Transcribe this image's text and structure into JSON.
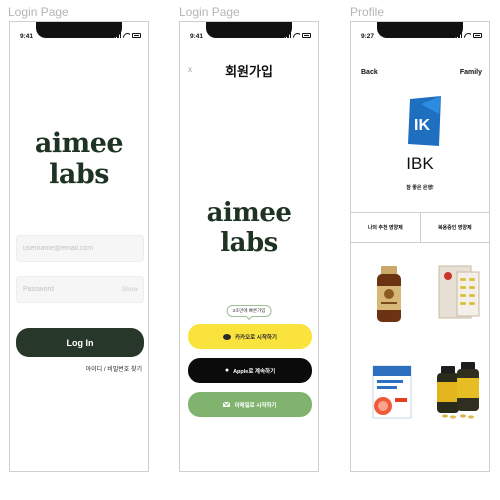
{
  "screens": [
    {
      "label": "Login Page"
    },
    {
      "label": "Login Page"
    },
    {
      "label": "Profile"
    }
  ],
  "status": {
    "time_login": "9:41",
    "time_signup": "9:41",
    "time_profile": "9:27"
  },
  "brand": {
    "logo_text": "aimee labs",
    "logo_color": "#1f3322"
  },
  "login": {
    "username_placeholder": "username@email.com",
    "password_placeholder": "Password",
    "show_label": "Show",
    "login_button": "Log In",
    "find_link": "아이디 / 비밀번호 찾기",
    "button_color": "#27382a"
  },
  "signup": {
    "close_icon": "x",
    "title": "회원가입",
    "tooltip": "3초만에 빠른가입",
    "kakao_button": "카카오로 시작하기",
    "apple_button": "Apple로 계속하기",
    "email_button": "이메일로 시작하기",
    "kakao_color": "#fbe33d",
    "apple_color": "#0b0b0b",
    "email_color": "#7fb36e"
  },
  "profile": {
    "back": "Back",
    "family": "Family",
    "bank_name": "IBK",
    "slogan": "참 좋은 은행!",
    "tabs": [
      "나의 추천 영양제",
      "복용중인 영양제"
    ],
    "products": [
      "vitamin-bottle",
      "supplement-box",
      "omega-box",
      "capsule-bottle"
    ]
  }
}
